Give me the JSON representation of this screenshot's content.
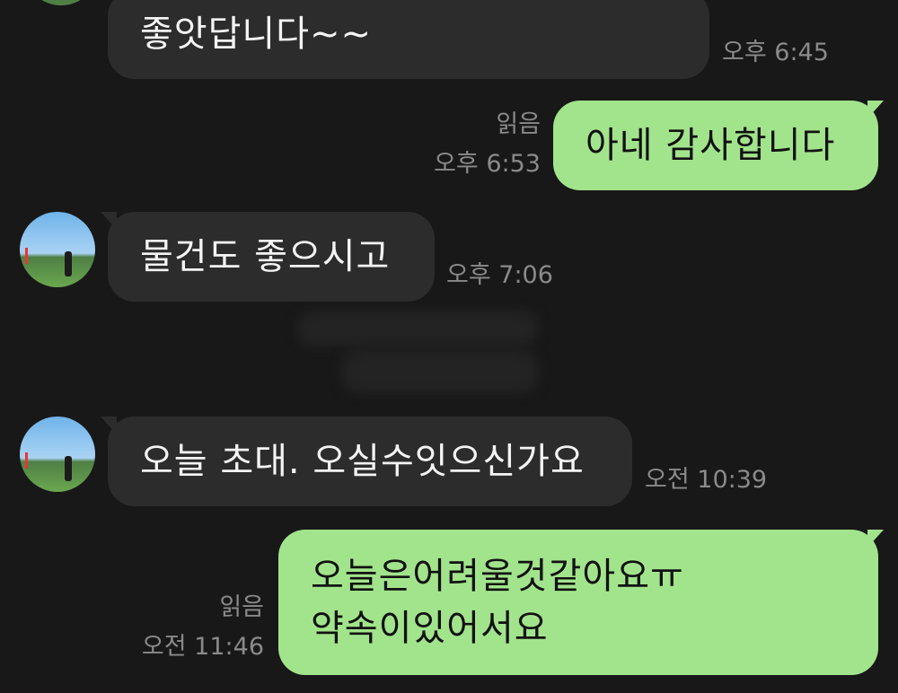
{
  "messages": [
    {
      "id": "m1",
      "direction": "in",
      "lines": [
        "좋앗답니다~~"
      ],
      "time": "오후 6:45"
    },
    {
      "id": "m2",
      "direction": "out",
      "lines": [
        "아네 감사합니다"
      ],
      "time": "오후 6:53",
      "read": "읽음"
    },
    {
      "id": "m3",
      "direction": "in",
      "lines": [
        "물건도 좋으시고"
      ],
      "time": "오후 7:06"
    },
    {
      "id": "m4",
      "direction": "in",
      "lines": [
        "오늘 초대. 오실수잇으신가요"
      ],
      "time": "오전 10:39"
    },
    {
      "id": "m5",
      "direction": "out",
      "lines": [
        "오늘은어려울것같아요ㅠ",
        "약속이있어서요"
      ],
      "time": "오전 11:46",
      "read": "읽음"
    }
  ],
  "contact": {
    "avatar_icon": "golf-course-profile-photo"
  },
  "colors": {
    "background": "#181818",
    "incoming_bubble": "#2c2c2c",
    "outgoing_bubble": "#a2e48c",
    "meta_text": "#8a8a8a"
  }
}
